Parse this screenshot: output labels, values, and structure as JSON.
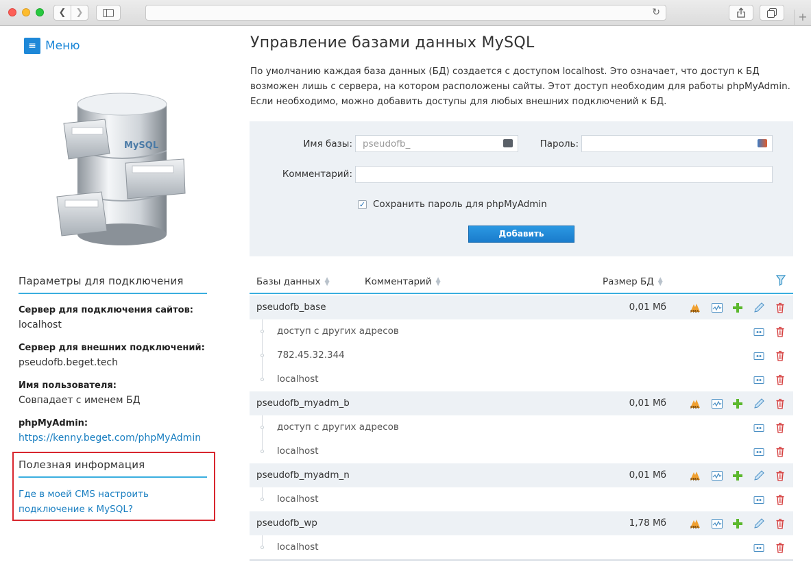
{
  "menu": {
    "label": "Меню"
  },
  "page": {
    "title": "Управление базами данных MySQL",
    "description": "По умолчанию каждая база данных (БД) создается с доступом localhost. Это означает, что доступ к БД возможен лишь с сервера, на котором расположены сайты. Этот доступ необходим для работы phpMyAdmin. Если необходимо, можно добавить доступы для любых внешних подключений к БД."
  },
  "form": {
    "db_name_label": "Имя базы:",
    "db_name_value": "pseudofb_",
    "password_label": "Пароль:",
    "password_value": "",
    "comment_label": "Комментарий:",
    "comment_value": "",
    "save_password_label": "Сохранить пароль для phpMyAdmin",
    "save_password_checked": true,
    "add_button": "Добавить"
  },
  "sidebar": {
    "connection_title": "Параметры для подключения",
    "site_server_label": "Сервер для подключения сайтов:",
    "site_server_value": "localhost",
    "external_server_label": "Сервер для внешних подключений:",
    "external_server_value": "pseudofb.beget.tech",
    "username_label": "Имя пользователя:",
    "username_value": "Совпадает с именем БД",
    "pma_label": "phpMyAdmin:",
    "pma_link": "https://kenny.beget.com/phpMyAdmin",
    "useful_title": "Полезная информация",
    "useful_link": "Где в моей CMS настроить подключение к MySQL?",
    "db_art_label": "MySQL"
  },
  "table": {
    "col_db": "Базы данных",
    "col_comment": "Комментарий",
    "col_size": "Размер БД",
    "databases": [
      {
        "name": "pseudofb_base",
        "size": "0,01 Мб",
        "access": [
          "доступ с других адресов",
          "782.45.32.344",
          "localhost"
        ]
      },
      {
        "name": "pseudofb_myadm_b",
        "size": "0,01 Мб",
        "access": [
          "доступ с других адресов",
          "localhost"
        ]
      },
      {
        "name": "pseudofb_myadm_n",
        "size": "0,01 Мб",
        "access": [
          "localhost"
        ]
      },
      {
        "name": "pseudofb_wp",
        "size": "1,78 Мб",
        "access": [
          "localhost"
        ]
      }
    ]
  },
  "icons": {
    "pma": "phpmyadmin-icon",
    "stats": "stats-icon",
    "add": "add-access-icon",
    "edit": "edit-icon",
    "delete": "delete-icon",
    "access_settings": "access-settings-icon",
    "filter": "filter-icon"
  },
  "colors": {
    "accent": "#1e88d8",
    "panel_bg": "#edf1f5",
    "underline": "#3aaedf",
    "highlight_box": "#d8262e",
    "add_green": "#5cb82e",
    "delete_red": "#d43a3a"
  }
}
